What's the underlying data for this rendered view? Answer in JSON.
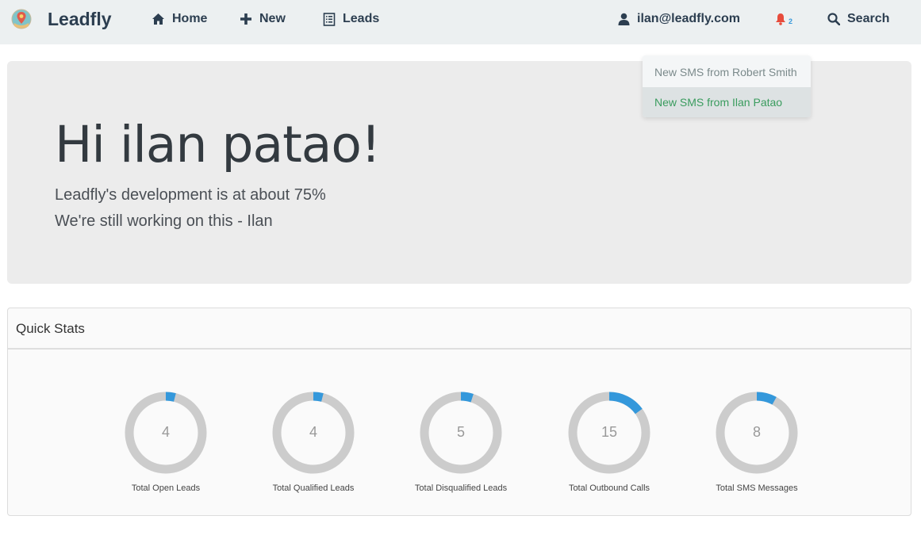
{
  "navbar": {
    "brand": "Leadfly",
    "items": [
      {
        "label": "Home",
        "icon": "home-icon"
      },
      {
        "label": "New",
        "icon": "plus-icon"
      },
      {
        "label": "Leads",
        "icon": "list-icon"
      }
    ],
    "user_email": "ilan@leadfly.com",
    "notification_count": "2",
    "search_label": "Search"
  },
  "dropdown": {
    "items": [
      "New SMS from Robert Smith",
      "New SMS from Ilan Patao"
    ]
  },
  "jumbotron": {
    "greeting": "Hi ilan patao!",
    "line1": "Leadfly's development is at about 75%",
    "line2": "We're still working on this - Ilan"
  },
  "quick_stats": {
    "title": "Quick Stats",
    "stats": [
      {
        "label": "Total Open Leads",
        "value": 4,
        "fraction": 0.04
      },
      {
        "label": "Total Qualified Leads",
        "value": 4,
        "fraction": 0.04
      },
      {
        "label": "Total Disqualified Leads",
        "value": 5,
        "fraction": 0.05
      },
      {
        "label": "Total Outbound Calls",
        "value": 15,
        "fraction": 0.15
      },
      {
        "label": "Total SMS Messages",
        "value": 8,
        "fraction": 0.08
      }
    ]
  },
  "colors": {
    "accent": "#3498db",
    "ring_track": "#cccccc",
    "navbar_bg": "#ecf0f1",
    "notification": "#e74c3c",
    "dropdown_active_text": "#3a9c5e"
  }
}
